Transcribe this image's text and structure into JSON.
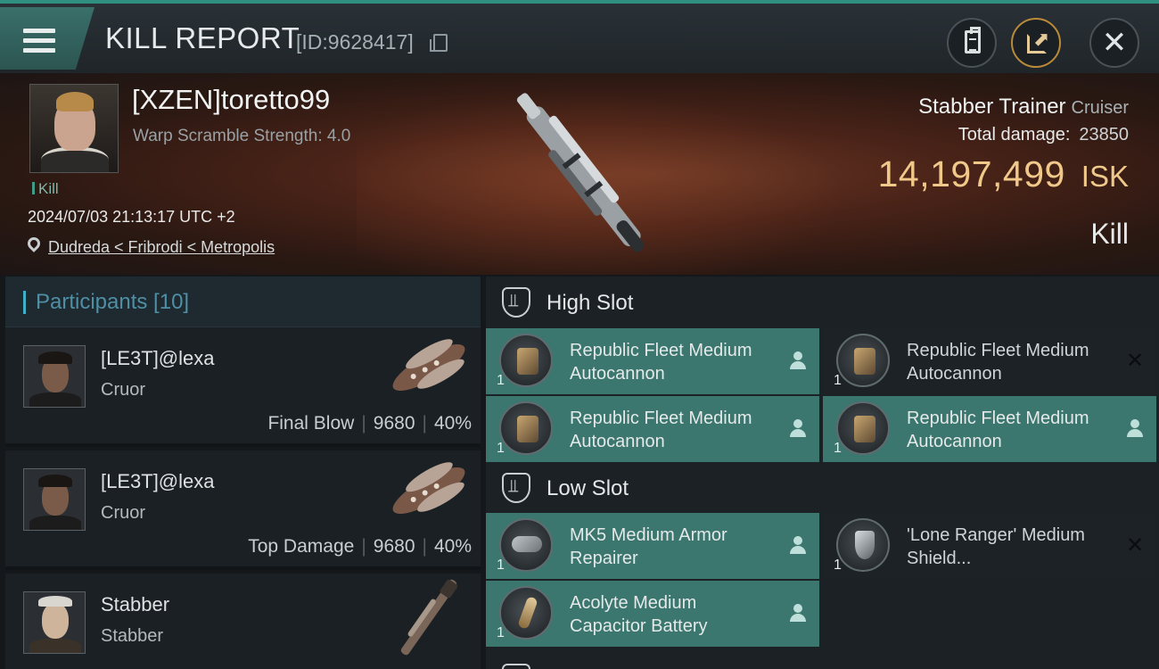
{
  "header": {
    "title": "KILL REPORT",
    "report_id": "[ID:9628417]"
  },
  "victim": {
    "name": "[XZEN]toretto99",
    "subtitle": "Warp Scramble Strength: 4.0",
    "kill_tag": "Kill",
    "datetime": "2024/07/03 21:13:17 UTC +2",
    "location": "Dudreda < Fribrodi < Metropolis"
  },
  "summary": {
    "ship_name": "Stabber Trainer",
    "ship_class": "Cruiser",
    "damage_label": "Total damage:",
    "damage_value": "23850",
    "isk_value": "14,197,499",
    "isk_unit": "ISK",
    "kill_type": "Kill"
  },
  "participants": {
    "label": "Participants [10]",
    "items": [
      {
        "name": "[LE3T]@lexa",
        "ship": "Cruor",
        "role": "Final Blow",
        "damage": "9680",
        "percent": "40%"
      },
      {
        "name": "[LE3T]@lexa",
        "ship": "Cruor",
        "role": "Top Damage",
        "damage": "9680",
        "percent": "40%"
      },
      {
        "name": "Stabber",
        "ship": "Stabber",
        "role": "",
        "damage": "",
        "percent": ""
      }
    ]
  },
  "fitting": {
    "high_slot": {
      "title": "High Slot",
      "modules": [
        {
          "name": "Republic Fleet Medium Autocannon",
          "qty": "1",
          "status": "active"
        },
        {
          "name": "Republic Fleet Medium Autocannon",
          "qty": "1",
          "status": "destroyed"
        },
        {
          "name": "Republic Fleet Medium Autocannon",
          "qty": "1",
          "status": "active"
        },
        {
          "name": "Republic Fleet Medium Autocannon",
          "qty": "1",
          "status": "active"
        }
      ]
    },
    "low_slot": {
      "title": "Low Slot",
      "modules": [
        {
          "name": "MK5 Medium Armor Repairer",
          "qty": "1",
          "status": "active"
        },
        {
          "name": "'Lone Ranger' Medium Shield...",
          "qty": "1",
          "status": "destroyed"
        },
        {
          "name": "Acolyte Medium Capacitor Battery",
          "qty": "1",
          "status": "active"
        }
      ]
    }
  },
  "colors": {
    "accent_teal": "#3b766f",
    "isk_gold": "#f0c98a",
    "header_bg": "#1f2529"
  },
  "icons": [
    "menu-icon",
    "copy-icon",
    "clipboard-icon",
    "share-icon",
    "close-icon",
    "pin-icon",
    "slot-icon",
    "person-icon",
    "x-icon"
  ]
}
